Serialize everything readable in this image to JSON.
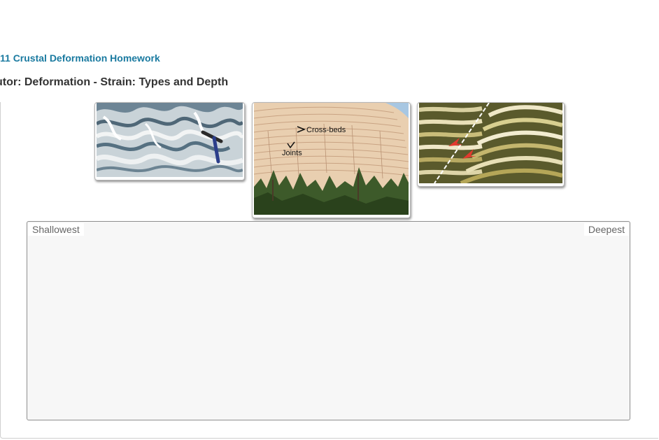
{
  "header": {
    "breadcrumb": "11 Crustal Deformation Homework",
    "title": "utor: Deformation - Strain: Types and Depth"
  },
  "photos": [
    {
      "name": "folded-rock-photo"
    },
    {
      "name": "sandstone-cliff-photo",
      "labels": {
        "crossbeds": "Cross-beds",
        "joints": "Joints"
      }
    },
    {
      "name": "faulted-strata-photo"
    }
  ],
  "dropzone": {
    "left_label": "Shallowest",
    "right_label": "Deepest"
  },
  "colors": {
    "link": "#1a7aa0",
    "title": "#333333",
    "zone_background": "#f7f7f7",
    "arrow_red": "#e23a2e"
  }
}
